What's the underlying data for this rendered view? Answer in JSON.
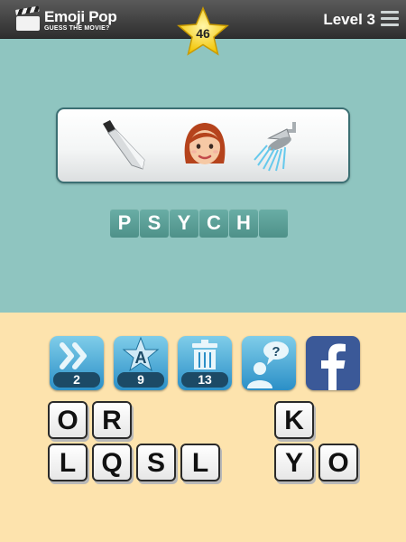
{
  "header": {
    "logo_title": "Emoji Pop",
    "logo_subtitle": "GUESS THE MOVIE?",
    "stars": "46",
    "level": "Level 3"
  },
  "puzzle": {
    "emojis": [
      "knife-emoji",
      "woman-emoji",
      "shower-emoji"
    ],
    "answer": [
      "P",
      "S",
      "Y",
      "C",
      "H",
      ""
    ]
  },
  "tools": [
    {
      "name": "skip",
      "count": "2"
    },
    {
      "name": "reveal-letter",
      "count": "9"
    },
    {
      "name": "remove-letters",
      "count": "13"
    },
    {
      "name": "ask-friend",
      "count": ""
    },
    {
      "name": "facebook",
      "count": ""
    }
  ],
  "letters": [
    "O",
    "R",
    "K",
    "L",
    "Q",
    "S",
    "L",
    "Y",
    "O"
  ],
  "colors": {
    "puzzle_bg": "#8fc5c0",
    "bottom_bg": "#fde3ad",
    "answer_tile": "#5a9f97",
    "tool_blue": "#2b8fc7",
    "facebook": "#3b5998"
  }
}
